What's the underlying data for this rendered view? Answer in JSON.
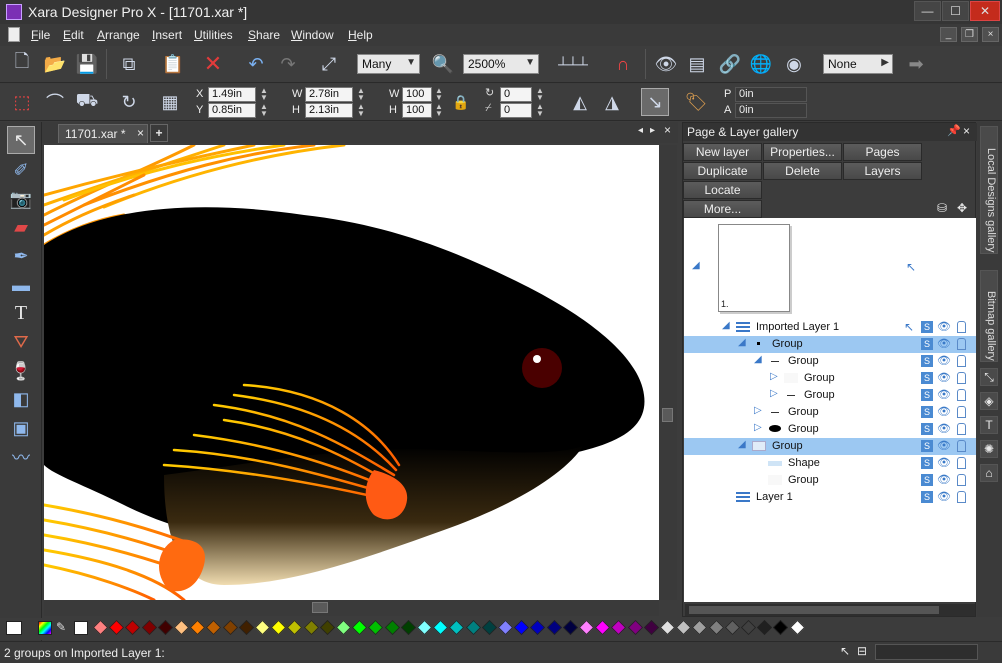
{
  "window": {
    "title": "Xara Designer Pro X - [11701.xar *]",
    "minimize": "—",
    "maximize": "☐",
    "close": "✕"
  },
  "menu": {
    "items": [
      "File",
      "Edit",
      "Arrange",
      "Insert",
      "Utilities",
      "Share",
      "Window",
      "Help"
    ]
  },
  "toolbar": {
    "quality": "Many",
    "zoom": "2500%",
    "fill_combo": "None"
  },
  "infobar": {
    "x": "1.49in",
    "y": "0.85in",
    "w": "2.78in",
    "h": "2.13in",
    "w_pct": "100",
    "h_pct": "100",
    "rotate": "0",
    "skew": "0",
    "p": "0in",
    "a": "0in",
    "x_label": "X",
    "y_label": "Y",
    "w_label": "W",
    "h_label": "H",
    "p_label": "P",
    "a_label": "A"
  },
  "document": {
    "tab_label": "11701.xar *",
    "close": "×",
    "add": "+"
  },
  "gallery": {
    "title": "Page & Layer gallery",
    "buttons": [
      "New layer",
      "Properties...",
      "Pages",
      "Duplicate",
      "Delete",
      "Layers",
      "Locate",
      "More..."
    ],
    "page_label": "1.",
    "tree": [
      {
        "label": "Imported Layer 1",
        "indent": 1,
        "expanded": true,
        "icon": "layer-icon",
        "selected": false
      },
      {
        "label": "Group",
        "indent": 2,
        "expanded": true,
        "icon": "dot-thumb",
        "selected": true
      },
      {
        "label": "Group",
        "indent": 3,
        "expanded": true,
        "icon": "dash-thumb",
        "selected": false
      },
      {
        "label": "Group",
        "indent": 4,
        "expanded": false,
        "icon": "blank-thumb",
        "selected": false
      },
      {
        "label": "Group",
        "indent": 4,
        "expanded": false,
        "icon": "dash-thumb",
        "selected": false
      },
      {
        "label": "Group",
        "indent": 3,
        "expanded": false,
        "icon": "dash-thumb",
        "selected": false
      },
      {
        "label": "Group",
        "indent": 3,
        "expanded": false,
        "icon": "fish-thumb",
        "selected": false
      },
      {
        "label": "Group",
        "indent": 2,
        "expanded": true,
        "icon": "rect-thumb",
        "selected": true
      },
      {
        "label": "Shape",
        "indent": 3,
        "expanded": null,
        "icon": "shape-thumb",
        "selected": false
      },
      {
        "label": "Group",
        "indent": 3,
        "expanded": null,
        "icon": "blank-thumb",
        "selected": false
      },
      {
        "label": "Layer 1",
        "indent": 1,
        "expanded": null,
        "icon": "layer-icon",
        "selected": false
      }
    ]
  },
  "side_tabs": [
    "Local Designs gallery",
    "Bitmap gallery"
  ],
  "palette": [
    "#ff8080",
    "#ff0000",
    "#c00000",
    "#800000",
    "#400000",
    "#ffc080",
    "#ff8000",
    "#c06000",
    "#804000",
    "#402000",
    "#ffff80",
    "#ffff00",
    "#c0c000",
    "#808000",
    "#404000",
    "#80ff80",
    "#00ff00",
    "#00c000",
    "#008000",
    "#004000",
    "#80ffff",
    "#00ffff",
    "#00c0c0",
    "#008080",
    "#004040",
    "#8080ff",
    "#0000ff",
    "#0000c0",
    "#000080",
    "#000040",
    "#ff80ff",
    "#ff00ff",
    "#c000c0",
    "#800080",
    "#400040",
    "#e0e0e0",
    "#c0c0c0",
    "#a0a0a0",
    "#808080",
    "#606060",
    "#404040",
    "#202020",
    "#000000",
    "#ffffff"
  ],
  "status": {
    "text": "2 groups on Imported Layer 1:"
  }
}
